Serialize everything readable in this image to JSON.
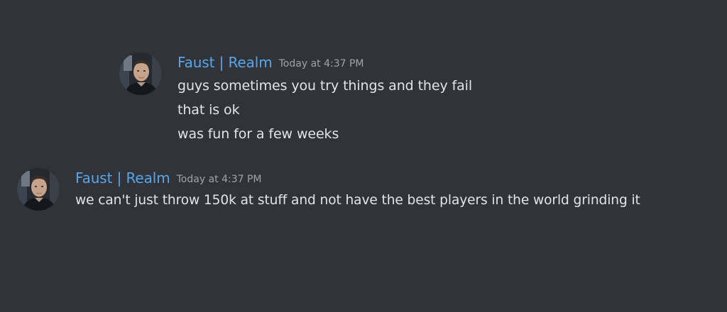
{
  "messages": [
    {
      "author": "Faust | Realm",
      "timestamp": "Today at 4:37 PM",
      "avatar_icon": "user-avatar",
      "lines": [
        "guys sometimes you try things and they fail",
        "that is ok",
        "was fun for a few weeks"
      ]
    },
    {
      "author": "Faust | Realm",
      "timestamp": "Today at 4:37 PM",
      "avatar_icon": "user-avatar",
      "lines": [
        "we can't just throw 150k at stuff and not have the best players in the world grinding it"
      ]
    }
  ],
  "colors": {
    "background": "#313338",
    "username": "#58a6e8",
    "timestamp": "#9fa3aa",
    "message_text": "#e3e4e7"
  }
}
